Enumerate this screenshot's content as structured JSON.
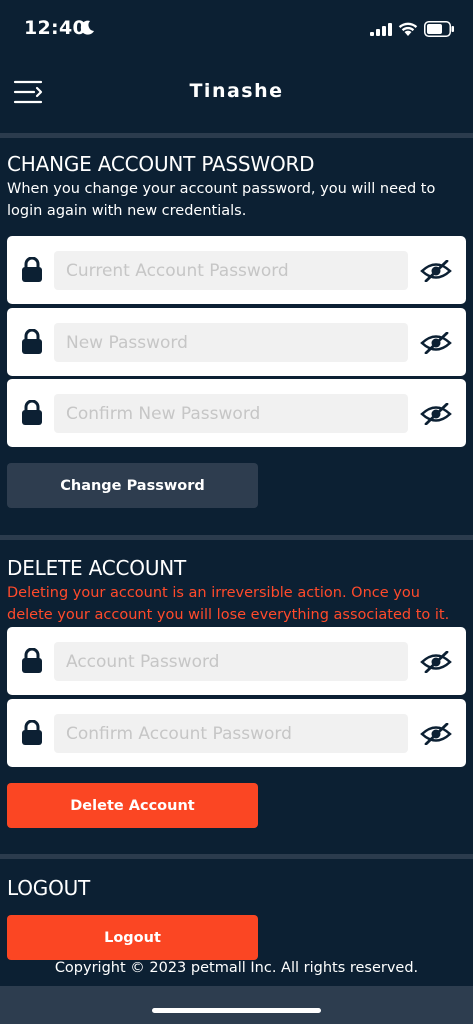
{
  "status_bar": {
    "time": "12:40"
  },
  "header": {
    "title": "Tinashe"
  },
  "change_password": {
    "title": "CHANGE ACCOUNT PASSWORD",
    "description": "When you change your account password, you will need to login again with new credentials.",
    "fields": [
      {
        "placeholder": "Current Account Password"
      },
      {
        "placeholder": "New Password"
      },
      {
        "placeholder": "Confirm New Password"
      }
    ],
    "button_label": "Change Password"
  },
  "delete_account": {
    "title": "DELETE ACCOUNT",
    "description": "Deleting your account is an irreversible action. Once you delete your account you will lose everything associated to it.",
    "fields": [
      {
        "placeholder": "Account Password"
      },
      {
        "placeholder": "Confirm Account Password"
      }
    ],
    "button_label": "Delete Account"
  },
  "logout": {
    "title": "LOGOUT",
    "button_label": "Logout"
  },
  "footer": {
    "copyright": "Copyright © 2023 petmall Inc. All rights reserved."
  },
  "colors": {
    "background": "#0c2033",
    "danger": "#fb4623",
    "button_dark": "#2e3d4f",
    "divider": "#2b3b4d"
  }
}
